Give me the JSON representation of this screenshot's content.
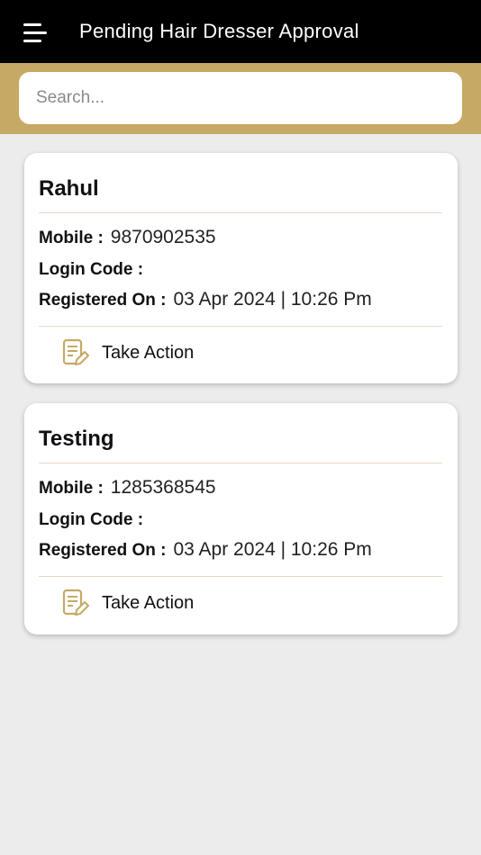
{
  "header": {
    "title": "Pending Hair Dresser Approval",
    "menu_icon": "hamburger-menu-icon"
  },
  "search": {
    "placeholder": "Search..."
  },
  "labels": {
    "mobile": "Mobile :",
    "login_code": "Login Code :",
    "registered_on": "Registered On :"
  },
  "cards": [
    {
      "name": "Rahul",
      "mobile": "9870902535",
      "login_code": "",
      "registered_on": "03 Apr 2024 | 10:26 Pm",
      "action_label": "Take Action"
    },
    {
      "name": "Testing",
      "mobile": "1285368545",
      "login_code": "",
      "registered_on": "03 Apr 2024 | 10:26 Pm",
      "action_label": "Take Action"
    }
  ],
  "colors": {
    "topbar": "#000000",
    "accent_gold": "#c6a964",
    "background": "#ececec",
    "divider": "#ead7c4"
  }
}
